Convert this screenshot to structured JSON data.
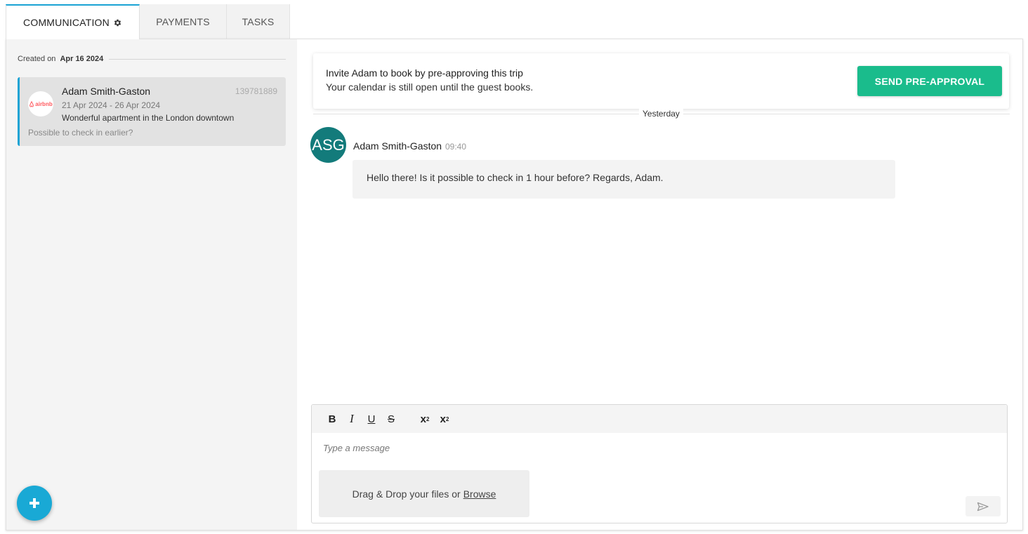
{
  "tabs": [
    {
      "label": "COMMUNICATION",
      "icon": "gear-icon"
    },
    {
      "label": "PAYMENTS"
    },
    {
      "label": "TASKS"
    }
  ],
  "sidebar": {
    "created_label": "Created on",
    "created_date": "Apr 16 2024",
    "conversation": {
      "channel_logo_text": "airbnb",
      "guest_name": "Adam Smith-Gaston",
      "reservation_id": "139781889",
      "dates": "21 Apr 2024 - 26 Apr 2024",
      "listing": "Wonderful apartment in the London downtown",
      "preview": "Possible to check in earlier?"
    },
    "fab_icon": "plus-icon"
  },
  "banner": {
    "title": "Invite Adam to book by pre-approving this trip",
    "subtitle": "Your calendar is still open until the guest books.",
    "button": "SEND PRE-APPROVAL"
  },
  "thread": {
    "day_divider": "Yesterday",
    "messages": [
      {
        "avatar_initials": "ASG",
        "sender": "Adam Smith-Gaston",
        "time": "09:40",
        "text": "Hello there! Is it possible to check in 1 hour before? Regards, Adam."
      }
    ]
  },
  "composer": {
    "toolbar": {
      "bold": "B",
      "italic": "I",
      "underline": "U",
      "strike": "S",
      "subscript_base": "x",
      "subscript_mark": "2",
      "superscript_base": "x",
      "superscript_mark": "2"
    },
    "placeholder": "Type a message",
    "dropzone_text": "Drag & Drop your files or",
    "browse_link": "Browse",
    "send_icon": "send-icon"
  },
  "colors": {
    "accent_blue": "#1aa3d4",
    "action_green": "#1abc8c",
    "avatar_teal": "#137b7b",
    "airbnb_red": "#ff5a5f"
  }
}
